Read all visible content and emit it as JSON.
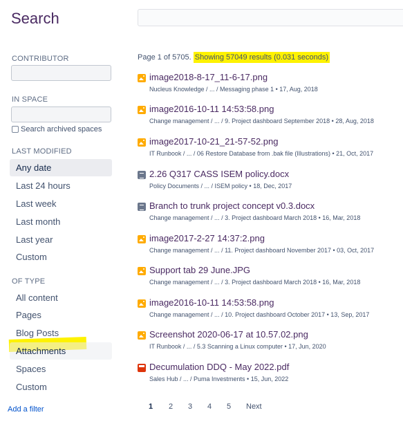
{
  "header": {
    "title": "Search",
    "search_value": ""
  },
  "sidebar": {
    "contributor_label": "CONTRIBUTOR",
    "in_space_label": "IN SPACE",
    "archived_label": "Search archived spaces",
    "last_modified_label": "LAST MODIFIED",
    "last_modified_options": [
      "Any date",
      "Last 24 hours",
      "Last week",
      "Last month",
      "Last year",
      "Custom"
    ],
    "of_type_label": "OF TYPE",
    "type_options": [
      "All content",
      "Pages",
      "Blog Posts",
      "Attachments",
      "Spaces",
      "Custom"
    ],
    "add_filter": "Add a filter"
  },
  "summary": {
    "page_text": "Page 1 of 5705.",
    "results_text": "Showing 57049 results (0.031 seconds)"
  },
  "results": [
    {
      "icon": "image",
      "title": "image2018-8-17_11-6-17.png",
      "meta": "Nucleus Knowledge / ... / Messaging phase 1 • 17, Aug, 2018"
    },
    {
      "icon": "image",
      "title": "image2016-10-11 14:53:58.png",
      "meta": "Change management / ... / 9. Project dashboard September 2018 • 28, Aug, 2018"
    },
    {
      "icon": "image",
      "title": "image2017-10-21_21-57-52.png",
      "meta": "IT Runbook / ... / 06 Restore Database from .bak file (Illustrations) • 21, Oct, 2017"
    },
    {
      "icon": "doc",
      "title": "2.26 Q317 CASS ISEM policy.docx",
      "meta": "Policy Documents / ... / ISEM policy • 18, Dec, 2017"
    },
    {
      "icon": "doc",
      "title": "Branch to trunk project concept v0.3.docx",
      "meta": "Change management / ... / 3. Project dashboard March 2018 • 16, Mar, 2018"
    },
    {
      "icon": "image",
      "title": "image2017-2-27 14:37:2.png",
      "meta": "Change management / ... / 11. Project dashboard November 2017 • 03, Oct, 2017"
    },
    {
      "icon": "image",
      "title": "Support tab 29 June.JPG",
      "meta": "Change management / ... / 3. Project dashboard March 2018 • 16, Mar, 2018"
    },
    {
      "icon": "image",
      "title": "image2016-10-11 14:53:58.png",
      "meta": "Change management / ... / 10. Project dashboard October 2017 • 13, Sep, 2017"
    },
    {
      "icon": "image",
      "title": "Screenshot 2020-06-17 at 10.57.02.png",
      "meta": "IT Runbook / ... / 5.3 Scanning a Linux computer • 17, Jun, 2020"
    },
    {
      "icon": "pdf",
      "title": "Decumulation DDQ - May 2022.pdf",
      "meta": "Sales Hub / ... / Puma Investments • 15, Jun, 2022"
    }
  ],
  "pagination": {
    "pages": [
      "1",
      "2",
      "3",
      "4",
      "5"
    ],
    "current": "1",
    "next_label": "Next"
  },
  "colors": {
    "accent": "#4a2a62",
    "highlight": "#fef200",
    "image_icon": "#ffab00",
    "doc_icon": "#6b778c",
    "pdf_icon": "#de350b"
  }
}
